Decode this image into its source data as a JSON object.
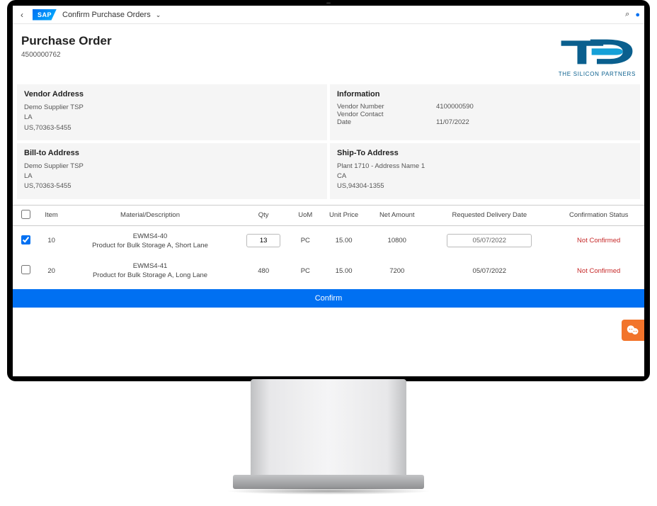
{
  "shell": {
    "title": "Confirm Purchase Orders"
  },
  "page": {
    "title": "Purchase Order",
    "po_number": "4500000762"
  },
  "logo": {
    "text": "THE SILICON PARTNERS"
  },
  "vendor_address": {
    "heading": "Vendor Address",
    "name": "Demo Supplier TSP",
    "city": "LA",
    "zip": "US,70363-5455"
  },
  "information": {
    "heading": "Information",
    "vendor_number_label": "Vendor Number",
    "vendor_number": "4100000590",
    "vendor_contact_label": "Vendor Contact",
    "vendor_contact": "",
    "date_label": "Date",
    "date": "11/07/2022"
  },
  "billto": {
    "heading": "Bill-to Address",
    "name": "Demo Supplier TSP",
    "city": "LA",
    "zip": "US,70363-5455"
  },
  "shipto": {
    "heading": "Ship-To Address",
    "name": "Plant 1710 - Address Name 1",
    "city": "CA",
    "zip": "US,94304-1355"
  },
  "table": {
    "headers": {
      "item": "Item",
      "material": "Material/Description",
      "qty": "Qty",
      "uom": "UoM",
      "unit_price": "Unit Price",
      "net_amount": "Net Amount",
      "req_date": "Requested Delivery Date",
      "conf_status": "Confirmation Status"
    },
    "rows": [
      {
        "checked": true,
        "item": "10",
        "material": "EWMS4-40",
        "description": "Product for Bulk Storage A, Short Lane",
        "qty": "13",
        "qty_editable": true,
        "uom": "PC",
        "unit_price": "15.00",
        "net_amount": "10800",
        "req_date": "05/07/2022",
        "date_editable": true,
        "conf_status": "Not Confirmed"
      },
      {
        "checked": false,
        "item": "20",
        "material": "EWMS4-41",
        "description": "Product for Bulk Storage A, Long Lane",
        "qty": "480",
        "qty_editable": false,
        "uom": "PC",
        "unit_price": "15.00",
        "net_amount": "7200",
        "req_date": "05/07/2022",
        "date_editable": false,
        "conf_status": "Not Confirmed"
      }
    ]
  },
  "confirm_label": "Confirm"
}
